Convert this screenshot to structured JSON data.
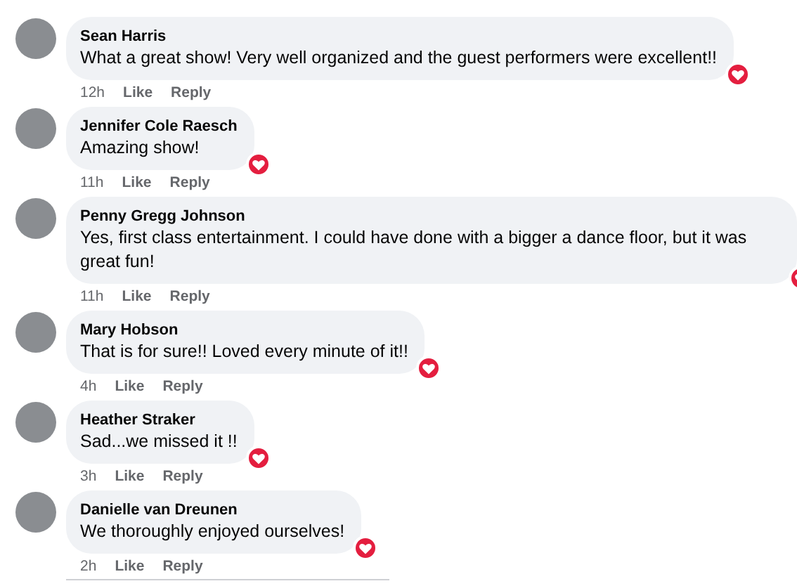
{
  "comments": [
    {
      "author": "Sean Harris",
      "text": "What a great show! Very well organized and the guest performers were excellent!!",
      "time": "12h",
      "like": "Like",
      "reply": "Reply"
    },
    {
      "author": "Jennifer Cole Raesch",
      "text": "Amazing show!",
      "time": "11h",
      "like": "Like",
      "reply": "Reply"
    },
    {
      "author": "Penny Gregg Johnson",
      "text": "Yes, first class entertainment. I could have done with a bigger a dance floor, but it was great fun!",
      "time": "11h",
      "like": "Like",
      "reply": "Reply"
    },
    {
      "author": "Mary Hobson",
      "text": "That is for sure!! Loved every minute of it!!",
      "time": "4h",
      "like": "Like",
      "reply": "Reply"
    },
    {
      "author": "Heather Straker",
      "text": "Sad...we missed it !!",
      "time": "3h",
      "like": "Like",
      "reply": "Reply"
    },
    {
      "author": "Danielle van Dreunen",
      "text": "We thoroughly enjoyed ourselves!",
      "time": "2h",
      "like": "Like",
      "reply": "Reply"
    }
  ]
}
